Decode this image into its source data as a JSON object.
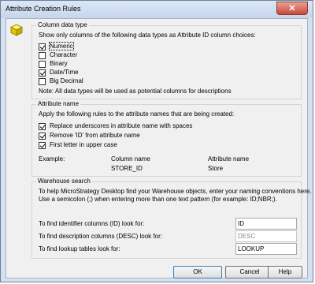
{
  "window": {
    "title": "Attribute Creation Rules",
    "close_glyph": "✕"
  },
  "column_group": {
    "legend": "Column data type",
    "description": "Show only columns of the following data types as Attribute ID column choices:",
    "options": [
      {
        "label": "Numeric",
        "checked": true
      },
      {
        "label": "Character",
        "checked": false
      },
      {
        "label": "Binary",
        "checked": false
      },
      {
        "label": "Date/Time",
        "checked": true
      },
      {
        "label": "Big Decimal",
        "checked": false
      }
    ],
    "note": "Note: All data types will be used as potential columns for descriptions"
  },
  "attribute_group": {
    "legend": "Attribute name",
    "description": "Apply the following rules to the attribute names that are being created:",
    "rules": [
      {
        "label": "Replace underscores in attribute name with spaces",
        "checked": true
      },
      {
        "label": "Remove 'ID' from attribute name",
        "checked": true
      },
      {
        "label": "First letter in upper case",
        "checked": true
      }
    ],
    "example_label": "Example:",
    "column_name_header": "Column name",
    "attribute_name_header": "Attribute name",
    "column_name_value": "STORE_ID",
    "attribute_name_value": "Store"
  },
  "warehouse_group": {
    "legend": "Warehouse search",
    "description_line1": "To help MicroStrategy Desktop find your Warehouse objects, enter your naming conventions here.",
    "description_line2": "Use a semicolon (;) when entering more than one text pattern (for example: ID;NBR;).",
    "fields": [
      {
        "label": "To find identifier columns (ID) look for:",
        "value": "ID",
        "disabled": false
      },
      {
        "label": "To find description columns (DESC) look for:",
        "value": "DESC",
        "disabled": true
      },
      {
        "label": "To find lookup tables look for:",
        "value": "LOOKUP",
        "disabled": false
      }
    ]
  },
  "buttons": {
    "ok": "OK",
    "cancel": "Cancel",
    "help": "Help"
  },
  "icons": {
    "app": "cube-icon",
    "close": "close-icon"
  }
}
